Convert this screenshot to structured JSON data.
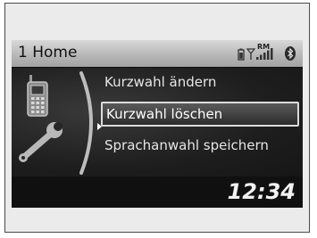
{
  "header": {
    "title": "1 Home",
    "status": {
      "roaming_label": "RM",
      "icons": [
        "battery-icon",
        "signal-strength-icon",
        "bluetooth-icon"
      ]
    }
  },
  "menu": {
    "items": [
      {
        "label": "Kurzwahl ändern"
      },
      {
        "label": "Kurzwahl löschen"
      },
      {
        "label": "Sprachanwahl speichern"
      }
    ],
    "selected_index": 1
  },
  "footer": {
    "clock": "12:34"
  },
  "colors": {
    "header_bg": "#c0c0c0",
    "screen_bg": "#1a1a1a",
    "text": "#e6e6e6",
    "selection_border": "#dcdcdc",
    "frame_bg": "#ebebeb"
  },
  "icons": {
    "main": "phone-settings-icon"
  }
}
